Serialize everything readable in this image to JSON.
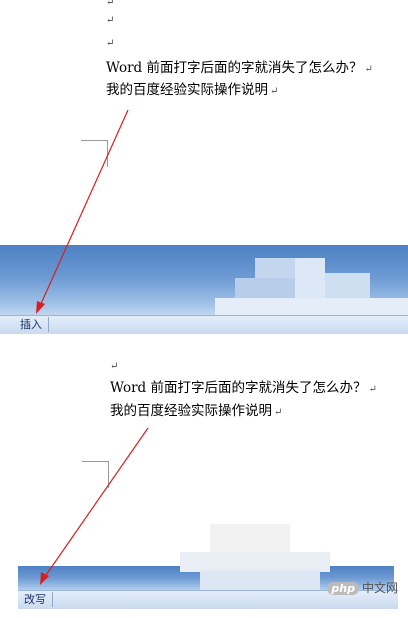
{
  "top_panel": {
    "paragraph_mark": "↵",
    "line1": "Word 前面打字后面的字就消失了怎么办？",
    "line2": "我的百度经验实际操作说明",
    "status_button": "插入"
  },
  "bottom_panel": {
    "paragraph_mark": "↵",
    "line1": "Word 前面打字后面的字就消失了怎么办？",
    "line2": "我的百度经验实际操作说明",
    "status_button": "改写"
  },
  "watermark": {
    "logo": "php",
    "text": "中文网"
  },
  "colors": {
    "arrow": "#d42020",
    "ribbon": "#5a8ccc",
    "statusbar": "#d4e3f5"
  }
}
